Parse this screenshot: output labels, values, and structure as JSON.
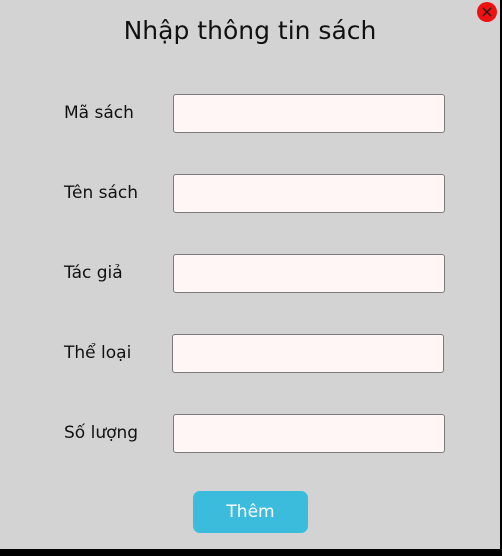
{
  "dialog": {
    "title": "Nhập thông tin sách",
    "close_label": "×"
  },
  "form": {
    "fields": [
      {
        "label": "Mã sách",
        "value": "",
        "placeholder": ""
      },
      {
        "label": "Tên sách",
        "value": "",
        "placeholder": ""
      },
      {
        "label": "Tác giả",
        "value": "",
        "placeholder": ""
      },
      {
        "label": "Thể loại",
        "value": "",
        "placeholder": ""
      },
      {
        "label": "Số lượng",
        "value": "",
        "placeholder": ""
      }
    ],
    "submit_label": "Thêm"
  },
  "colors": {
    "background": "#d3d3d3",
    "input_background": "#fff6f5",
    "button": "#3cbcdc",
    "close": "#ee1111"
  }
}
